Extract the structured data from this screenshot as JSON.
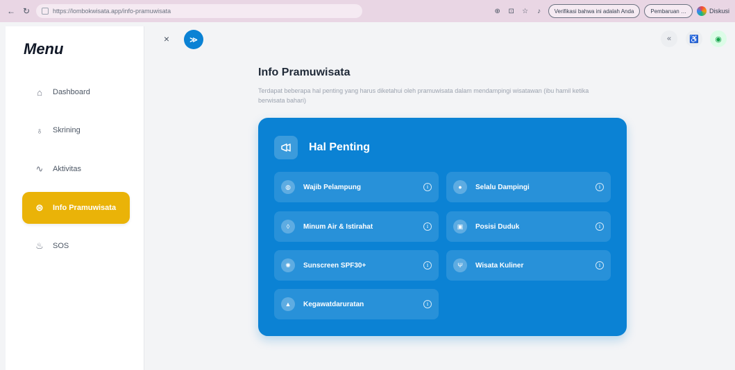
{
  "browser": {
    "url": "https://lombokwisata.app/info-pramuwisata",
    "back_icon": "arrow-left-icon",
    "reload_icon": "reload-icon",
    "pill_verify": "Verifikasi bahwa ini adalah Anda",
    "pill_paused": "Pembaruan …",
    "profile_label": "Diskusi"
  },
  "sidebar": {
    "title": "Menu",
    "items": [
      {
        "label": "Dashboard",
        "icon": "home-icon",
        "glyph": "⌂"
      },
      {
        "label": "Skrining",
        "icon": "lightbulb-icon",
        "glyph": "♁"
      },
      {
        "label": "Aktivitas",
        "icon": "activity-icon",
        "glyph": "∿"
      },
      {
        "label": "Info Pramuwisata",
        "icon": "megaphone-icon",
        "glyph": "⊜",
        "active": true
      },
      {
        "label": "SOS",
        "icon": "alarm-icon",
        "glyph": "♨"
      }
    ]
  },
  "header": {
    "close_glyph": "×",
    "logo_glyph": "≫"
  },
  "main": {
    "title": "Info Pramuwisata",
    "description": "Terdapat beberapa hal penting yang harus diketahui oleh pramuwisata dalam mendampingi wisatawan (ibu hamil ketika berwisata bahari)",
    "card": {
      "title": "Hal Penting",
      "items": [
        {
          "label": "Wajib Pelampung",
          "icon": "lifebuoy-icon",
          "glyph": "◍"
        },
        {
          "label": "Selalu Dampingi",
          "icon": "user-icon",
          "glyph": "●"
        },
        {
          "label": "Minum Air & Istirahat",
          "icon": "water-drop-icon",
          "glyph": "◊"
        },
        {
          "label": "Posisi Duduk",
          "icon": "chair-icon",
          "glyph": "▣"
        },
        {
          "label": "Sunscreen SPF30+",
          "icon": "sun-icon",
          "glyph": "✺"
        },
        {
          "label": "Wisata Kuliner",
          "icon": "utensils-icon",
          "glyph": "Ψ"
        },
        {
          "label": "Kegawatdaruratan",
          "icon": "alert-icon",
          "glyph": "▲"
        }
      ]
    }
  },
  "colors": {
    "primary": "#0b82d4",
    "accent": "#eab308",
    "browser_bar": "#e9d6e4"
  }
}
